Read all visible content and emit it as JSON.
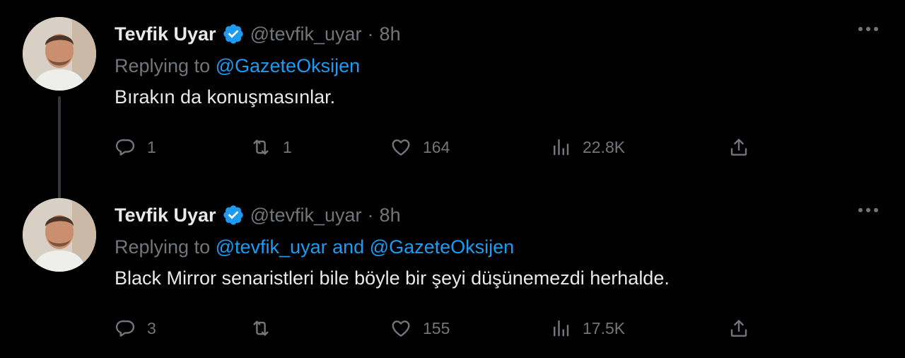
{
  "tweets": [
    {
      "name": "Tevfik Uyar",
      "handle": "@tevfik_uyar",
      "separator": "·",
      "time": "8h",
      "replying_prefix": "Replying to",
      "replying_to": "@GazeteOksijen",
      "replying_joiner": "",
      "replying_to_2": "",
      "text": "Bırakın da konuşmasınlar.",
      "replies": "1",
      "retweets": "1",
      "likes": "164",
      "views": "22.8K"
    },
    {
      "name": "Tevfik Uyar",
      "handle": "@tevfik_uyar",
      "separator": "·",
      "time": "8h",
      "replying_prefix": "Replying to",
      "replying_to": "@tevfik_uyar",
      "replying_joiner": "and",
      "replying_to_2": "@GazeteOksijen",
      "text": "Black Mirror senaristleri bile böyle bir şeyi düşünemezdi herhalde.",
      "replies": "3",
      "retweets": "",
      "likes": "155",
      "views": "17.5K"
    }
  ],
  "colors": {
    "background": "#000000",
    "text": "#e7e9ea",
    "muted": "#71767b",
    "accent": "#1d9bf0"
  },
  "icons": [
    "verified-badge-icon",
    "more-icon",
    "reply-icon",
    "retweet-icon",
    "like-icon",
    "views-icon",
    "share-icon"
  ]
}
